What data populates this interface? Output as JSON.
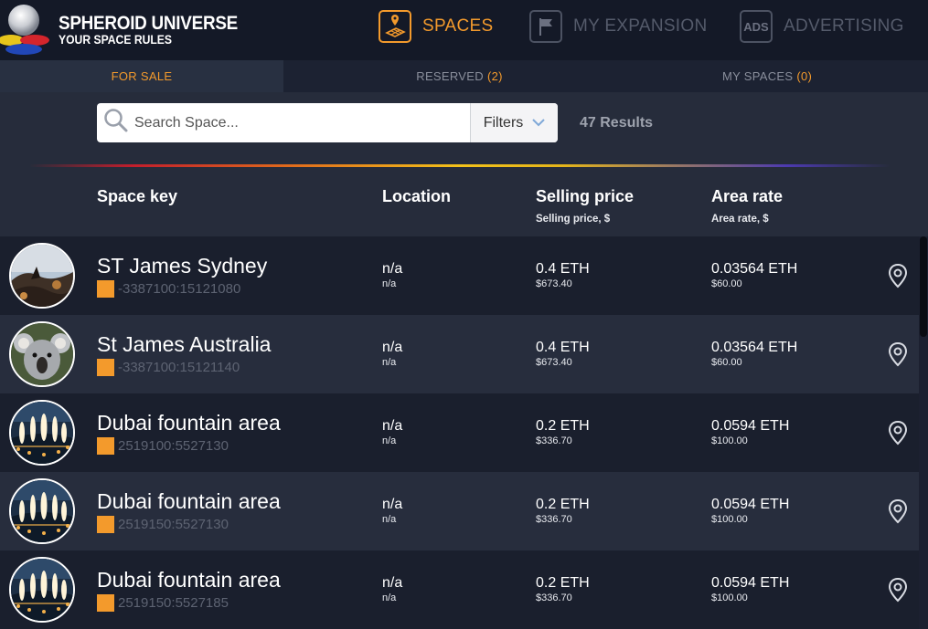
{
  "brand": {
    "title": "SPHEROID UNIVERSE",
    "subtitle": "YOUR SPACE RULES"
  },
  "nav": [
    {
      "label": "SPACES",
      "icon": "map-grid-icon",
      "active": true
    },
    {
      "label": "MY EXPANSION",
      "icon": "flag-icon",
      "active": false
    },
    {
      "label": "ADVERTISING",
      "icon": "ads-icon",
      "active": false
    }
  ],
  "tabs": [
    {
      "label": "FOR SALE",
      "count": ""
    },
    {
      "label": "RESERVED",
      "count": "(2)"
    },
    {
      "label": "MY SPACES",
      "count": "(0)"
    }
  ],
  "search": {
    "placeholder": "Search Space...",
    "value": "",
    "filters_label": "Filters",
    "results": "47 Results"
  },
  "columns": {
    "space_key": "Space key",
    "location": "Location",
    "selling_price": "Selling price",
    "selling_price_sub": "Selling price, $",
    "area_rate": "Area rate",
    "area_rate_sub": "Area rate, $"
  },
  "rows": [
    {
      "name": "ST James Sydney",
      "key": "-3387100:15121080",
      "location": "n/a",
      "location_sub": "n/a",
      "price": "0.4 ETH",
      "price_usd": "$673.40",
      "rate": "0.03564 ETH",
      "rate_usd": "$60.00",
      "image": "sydney-landscape"
    },
    {
      "name": "St James Australia",
      "key": "-3387100:15121140",
      "location": "n/a",
      "location_sub": "n/a",
      "price": "0.4 ETH",
      "price_usd": "$673.40",
      "rate": "0.03564 ETH",
      "rate_usd": "$60.00",
      "image": "koala"
    },
    {
      "name": "Dubai fountain area",
      "key": "2519100:5527130",
      "location": "n/a",
      "location_sub": "n/a",
      "price": "0.2 ETH",
      "price_usd": "$336.70",
      "rate": "0.0594 ETH",
      "rate_usd": "$100.00",
      "image": "dubai-fountain"
    },
    {
      "name": "Dubai fountain area",
      "key": "2519150:5527130",
      "location": "n/a",
      "location_sub": "n/a",
      "price": "0.2 ETH",
      "price_usd": "$336.70",
      "rate": "0.0594 ETH",
      "rate_usd": "$100.00",
      "image": "dubai-fountain"
    },
    {
      "name": "Dubai fountain area",
      "key": "2519150:5527185",
      "location": "n/a",
      "location_sub": "n/a",
      "price": "0.2 ETH",
      "price_usd": "$336.70",
      "rate": "0.0594 ETH",
      "rate_usd": "$100.00",
      "image": "dubai-fountain"
    }
  ],
  "colors": {
    "accent": "#f39a2c",
    "header_bg": "#141927",
    "body_bg": "#262c3b",
    "row_dark": "#1a1f2d",
    "row_light": "#272d3d"
  }
}
